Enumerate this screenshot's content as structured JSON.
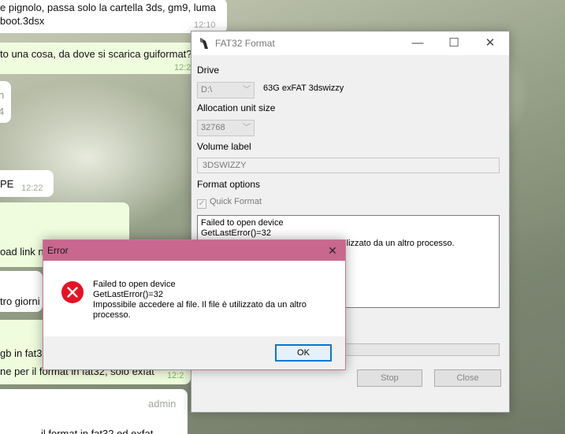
{
  "chat": {
    "bubbles": [
      {
        "line1": "e pignolo, passa solo la cartella 3ds, gm9, luma",
        "line2": "boot.3dsx",
        "time": "12:10"
      },
      {
        "text": "to una cosa, da dove si scarica guiformat?",
        "time": "12:2"
      },
      {
        "line1": "n",
        "line2": "4"
      },
      {
        "text": "PE",
        "time": "12:22"
      },
      {
        "text": "oad link n"
      },
      {
        "text": "tro giorni"
      },
      {
        "line1": "gb in fat3",
        "line2": "ne per il format in fat32, solo exfat",
        "time": "12:2"
      },
      {
        "author": "admin",
        "text": "il format in fat32 ed exfat"
      }
    ]
  },
  "fat32_window": {
    "title": "FAT32 Format",
    "controls": {
      "minimize": "—",
      "maximize": "☐",
      "close": "✕"
    },
    "drive_label": "Drive",
    "drive_value": "D:\\",
    "drive_description": "63G exFAT 3dswizzy",
    "alloc_label": "Allocation unit size",
    "alloc_value": "32768",
    "volume_label": "Volume label",
    "volume_value": "3DSWIZZY",
    "format_options_label": "Format options",
    "quick_format_label": "Quick Format",
    "quick_format_checked": true,
    "log_lines": [
      "Failed to open device",
      "GetLastError()=32",
      "Impossibile accedere al file. Il file è utilizzato da un altro processo."
    ],
    "stop_label": "Stop",
    "close_label": "Close"
  },
  "error_dialog": {
    "title": "Error",
    "close_glyph": "✕",
    "message_lines": [
      "Failed to open device",
      "GetLastError()=32",
      "Impossibile accedere al file. Il file è utilizzato da un altro",
      "processo."
    ],
    "ok_label": "OK",
    "icon": "error-x-icon",
    "icon_color": "#e81123"
  }
}
